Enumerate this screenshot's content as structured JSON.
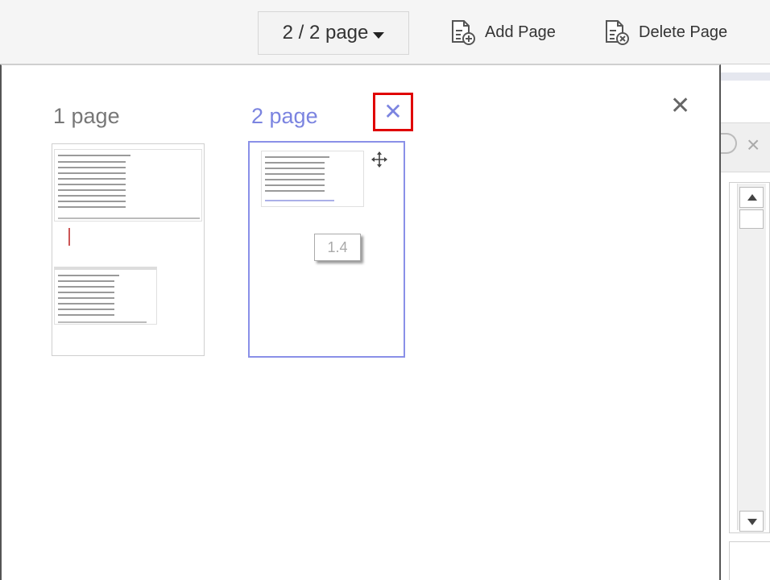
{
  "toolbar": {
    "page_select_value": "2 / 2 page",
    "add_page_label": "Add Page",
    "delete_page_label": "Delete Page"
  },
  "panel": {
    "pages": [
      {
        "label": "1 page",
        "selected": false
      },
      {
        "label": "2 page",
        "selected": true
      }
    ],
    "badge_value": "1.4"
  },
  "colors": {
    "accent": "#7b84e0",
    "highlight_box": "#e00000"
  },
  "icons": {
    "add_page": "add-page-icon",
    "delete_page": "delete-page-icon",
    "page_delete": "close-icon",
    "panel_close": "close-icon",
    "move": "move-icon"
  }
}
